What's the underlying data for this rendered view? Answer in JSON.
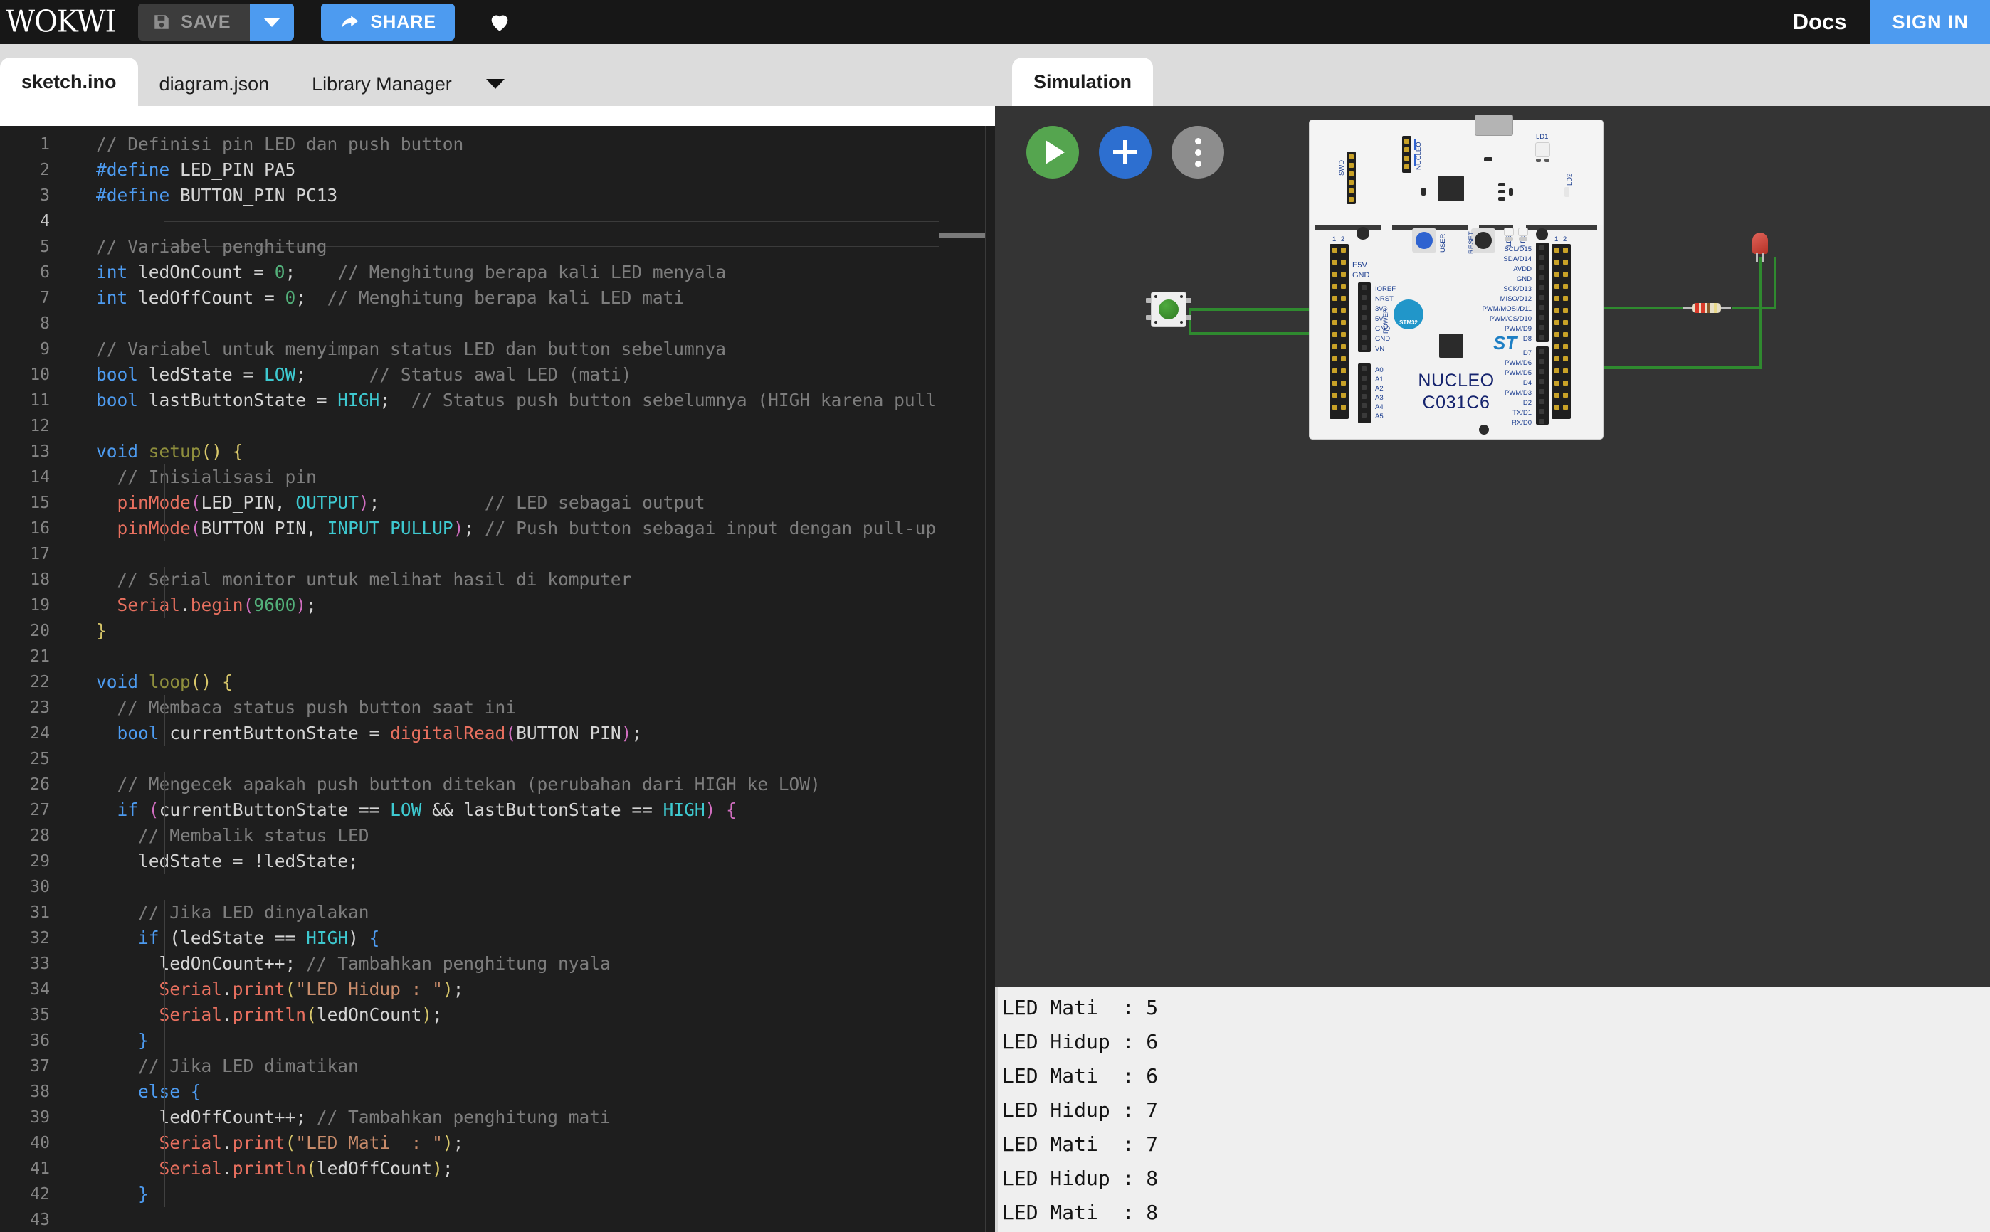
{
  "header": {
    "logo": "WOKWI",
    "save_label": "SAVE",
    "save_icon": "floppy-disk-icon",
    "save_caret_icon": "chevron-down-icon",
    "share_label": "SHARE",
    "share_icon": "share-arrow-icon",
    "heart_icon": "heart-icon",
    "docs_label": "Docs",
    "signin_label": "SIGN IN",
    "accent_blue": "#4d9bf0",
    "bar_bg": "#171717"
  },
  "editor": {
    "tabs": [
      {
        "label": "sketch.ino",
        "active": true
      },
      {
        "label": "diagram.json",
        "active": false
      },
      {
        "label": "Library Manager",
        "active": false
      }
    ],
    "tab_overflow_icon": "chevron-down-icon",
    "current_line": 4,
    "lines": [
      {
        "n": 1,
        "tokens": [
          [
            "c",
            "// Definisi pin LED dan push button"
          ]
        ]
      },
      {
        "n": 2,
        "tokens": [
          [
            "pp",
            "#define"
          ],
          [
            "id",
            " LED_PIN PA5"
          ]
        ]
      },
      {
        "n": 3,
        "tokens": [
          [
            "pp",
            "#define"
          ],
          [
            "id",
            " BUTTON_PIN PC13"
          ]
        ]
      },
      {
        "n": 4,
        "tokens": []
      },
      {
        "n": 5,
        "tokens": [
          [
            "c",
            "// Variabel penghitung"
          ]
        ]
      },
      {
        "n": 6,
        "tokens": [
          [
            "kw",
            "int"
          ],
          [
            "id",
            " ledOnCount = "
          ],
          [
            "num",
            "0"
          ],
          [
            "id",
            ";"
          ],
          [
            "c",
            "    // Menghitung berapa kali LED menyala"
          ]
        ]
      },
      {
        "n": 7,
        "tokens": [
          [
            "kw",
            "int"
          ],
          [
            "id",
            " ledOffCount = "
          ],
          [
            "num",
            "0"
          ],
          [
            "id",
            ";"
          ],
          [
            "c",
            "  // Menghitung berapa kali LED mati"
          ]
        ]
      },
      {
        "n": 8,
        "tokens": []
      },
      {
        "n": 9,
        "tokens": [
          [
            "c",
            "// Variabel untuk menyimpan status LED dan button sebelumnya"
          ]
        ]
      },
      {
        "n": 10,
        "tokens": [
          [
            "kw",
            "bool"
          ],
          [
            "id",
            " ledState = "
          ],
          [
            "cy",
            "LOW"
          ],
          [
            "id",
            ";"
          ],
          [
            "c",
            "      // Status awal LED (mati)"
          ]
        ]
      },
      {
        "n": 11,
        "tokens": [
          [
            "kw",
            "bool"
          ],
          [
            "id",
            " lastButtonState = "
          ],
          [
            "cy",
            "HIGH"
          ],
          [
            "id",
            ";"
          ],
          [
            "c",
            "  // Status push button sebelumnya (HIGH karena pull-up)"
          ]
        ]
      },
      {
        "n": 12,
        "tokens": []
      },
      {
        "n": 13,
        "tokens": [
          [
            "kw",
            "void"
          ],
          [
            "id",
            " "
          ],
          [
            "fn",
            "setup"
          ],
          [
            "yl",
            "()"
          ],
          [
            "yl",
            " {"
          ]
        ]
      },
      {
        "n": 14,
        "tokens": [
          [
            "id",
            "  "
          ],
          [
            "c",
            "// Inisialisasi pin"
          ]
        ]
      },
      {
        "n": 15,
        "tokens": [
          [
            "id",
            "  "
          ],
          [
            "or",
            "pinMode"
          ],
          [
            "pk",
            "("
          ],
          [
            "id",
            "LED_PIN, "
          ],
          [
            "cy",
            "OUTPUT"
          ],
          [
            "pk",
            ")"
          ],
          [
            "id",
            ";"
          ],
          [
            "c",
            "          // LED sebagai output"
          ]
        ]
      },
      {
        "n": 16,
        "tokens": [
          [
            "id",
            "  "
          ],
          [
            "or",
            "pinMode"
          ],
          [
            "pk",
            "("
          ],
          [
            "id",
            "BUTTON_PIN, "
          ],
          [
            "cy",
            "INPUT_PULLUP"
          ],
          [
            "pk",
            ")"
          ],
          [
            "id",
            ";"
          ],
          [
            "c",
            " // Push button sebagai input dengan pull-up interna"
          ]
        ]
      },
      {
        "n": 17,
        "tokens": []
      },
      {
        "n": 18,
        "tokens": [
          [
            "id",
            "  "
          ],
          [
            "c",
            "// Serial monitor untuk melihat hasil di komputer"
          ]
        ]
      },
      {
        "n": 19,
        "tokens": [
          [
            "id",
            "  "
          ],
          [
            "or",
            "Serial"
          ],
          [
            "id",
            "."
          ],
          [
            "or",
            "begin"
          ],
          [
            "pk",
            "("
          ],
          [
            "num",
            "9600"
          ],
          [
            "pk",
            ")"
          ],
          [
            "id",
            ";"
          ]
        ]
      },
      {
        "n": 20,
        "tokens": [
          [
            "yl",
            "}"
          ]
        ]
      },
      {
        "n": 21,
        "tokens": []
      },
      {
        "n": 22,
        "tokens": [
          [
            "kw",
            "void"
          ],
          [
            "id",
            " "
          ],
          [
            "fn",
            "loop"
          ],
          [
            "yl",
            "()"
          ],
          [
            "yl",
            " {"
          ]
        ]
      },
      {
        "n": 23,
        "tokens": [
          [
            "id",
            "  "
          ],
          [
            "c",
            "// Membaca status push button saat ini"
          ]
        ]
      },
      {
        "n": 24,
        "tokens": [
          [
            "id",
            "  "
          ],
          [
            "kw",
            "bool"
          ],
          [
            "id",
            " currentButtonState = "
          ],
          [
            "or",
            "digitalRead"
          ],
          [
            "pk",
            "("
          ],
          [
            "id",
            "BUTTON_PIN"
          ],
          [
            "pk",
            ")"
          ],
          [
            "id",
            ";"
          ]
        ]
      },
      {
        "n": 25,
        "tokens": []
      },
      {
        "n": 26,
        "tokens": [
          [
            "id",
            "  "
          ],
          [
            "c",
            "// Mengecek apakah push button ditekan (perubahan dari HIGH ke LOW)"
          ]
        ]
      },
      {
        "n": 27,
        "tokens": [
          [
            "id",
            "  "
          ],
          [
            "kw",
            "if"
          ],
          [
            "id",
            " "
          ],
          [
            "pk",
            "("
          ],
          [
            "id",
            "currentButtonState == "
          ],
          [
            "cy",
            "LOW"
          ],
          [
            "id",
            " && lastButtonState == "
          ],
          [
            "cy",
            "HIGH"
          ],
          [
            "pk",
            ")"
          ],
          [
            "pk",
            " {"
          ]
        ]
      },
      {
        "n": 28,
        "tokens": [
          [
            "id",
            "    "
          ],
          [
            "c",
            "// Membalik status LED"
          ]
        ]
      },
      {
        "n": 29,
        "tokens": [
          [
            "id",
            "    ledState = !ledState;"
          ]
        ]
      },
      {
        "n": 30,
        "tokens": []
      },
      {
        "n": 31,
        "tokens": [
          [
            "id",
            "    "
          ],
          [
            "c",
            "// Jika LED dinyalakan"
          ]
        ]
      },
      {
        "n": 32,
        "tokens": [
          [
            "id",
            "    "
          ],
          [
            "kw",
            "if"
          ],
          [
            "id",
            " ("
          ],
          [
            "id",
            "ledState == "
          ],
          [
            "cy",
            "HIGH"
          ],
          [
            "id",
            ") "
          ],
          [
            "bl",
            "{"
          ]
        ]
      },
      {
        "n": 33,
        "tokens": [
          [
            "id",
            "      ledOnCount++; "
          ],
          [
            "c",
            "// Tambahkan penghitung nyala"
          ]
        ]
      },
      {
        "n": 34,
        "tokens": [
          [
            "id",
            "      "
          ],
          [
            "or",
            "Serial"
          ],
          [
            "id",
            "."
          ],
          [
            "or",
            "print"
          ],
          [
            "yl",
            "("
          ],
          [
            "st",
            "\"LED Hidup : \""
          ],
          [
            "yl",
            ")"
          ],
          [
            "id",
            ";"
          ]
        ]
      },
      {
        "n": 35,
        "tokens": [
          [
            "id",
            "      "
          ],
          [
            "or",
            "Serial"
          ],
          [
            "id",
            "."
          ],
          [
            "or",
            "println"
          ],
          [
            "yl",
            "("
          ],
          [
            "id",
            "ledOnCount"
          ],
          [
            "yl",
            ")"
          ],
          [
            "id",
            ";"
          ]
        ]
      },
      {
        "n": 36,
        "tokens": [
          [
            "id",
            "    "
          ],
          [
            "bl",
            "}"
          ]
        ]
      },
      {
        "n": 37,
        "tokens": [
          [
            "id",
            "    "
          ],
          [
            "c",
            "// Jika LED dimatikan"
          ]
        ]
      },
      {
        "n": 38,
        "tokens": [
          [
            "id",
            "    "
          ],
          [
            "kw",
            "else"
          ],
          [
            "id",
            " "
          ],
          [
            "bl",
            "{"
          ]
        ]
      },
      {
        "n": 39,
        "tokens": [
          [
            "id",
            "      ledOffCount++; "
          ],
          [
            "c",
            "// Tambahkan penghitung mati"
          ]
        ]
      },
      {
        "n": 40,
        "tokens": [
          [
            "id",
            "      "
          ],
          [
            "or",
            "Serial"
          ],
          [
            "id",
            "."
          ],
          [
            "or",
            "print"
          ],
          [
            "yl",
            "("
          ],
          [
            "st",
            "\"LED Mati  : \""
          ],
          [
            "yl",
            ")"
          ],
          [
            "id",
            ";"
          ]
        ]
      },
      {
        "n": 41,
        "tokens": [
          [
            "id",
            "      "
          ],
          [
            "or",
            "Serial"
          ],
          [
            "id",
            "."
          ],
          [
            "or",
            "println"
          ],
          [
            "yl",
            "("
          ],
          [
            "id",
            "ledOffCount"
          ],
          [
            "yl",
            ")"
          ],
          [
            "id",
            ";"
          ]
        ]
      },
      {
        "n": 42,
        "tokens": [
          [
            "id",
            "    "
          ],
          [
            "bl",
            "}"
          ]
        ]
      },
      {
        "n": 43,
        "tokens": []
      }
    ]
  },
  "simulation": {
    "tab_label": "Simulation",
    "controls": [
      {
        "name": "play-button",
        "icon": "play-icon",
        "color": "#55a54f"
      },
      {
        "name": "add-part-button",
        "icon": "plus-icon",
        "color": "#2d6fd0"
      },
      {
        "name": "more-options-button",
        "icon": "kebab-menu-icon",
        "color": "#8d8d8d"
      }
    ],
    "board": {
      "name_line1": "NUCLEO",
      "name_line2": "C031C6",
      "vendor": "ST",
      "mcu_badge": "STM32",
      "labels_left_power": [
        "IOREF",
        "NRST",
        "3V3",
        "5V",
        "GND",
        "GND",
        "VN"
      ],
      "labels_left_analog": [
        "A0",
        "A1",
        "A2",
        "A3",
        "A4",
        "A5"
      ],
      "labels_left_top": [
        "E5V",
        "GND"
      ],
      "power_group_label": "POWER",
      "labels_right_upper": [
        "SCL/D15",
        "SDA/D14",
        "AVDD",
        "GND",
        "SCK/D13",
        "MISO/D12",
        "PWM/MOSI/D11",
        "PWM/CS/D10",
        "PWM/D9",
        "D8"
      ],
      "labels_right_lower": [
        "D7",
        "PWM/D6",
        "PWM/D5",
        "D4",
        "PWM/D3",
        "D2",
        "TX/D1",
        "RX/D0"
      ],
      "header_labels": [
        "SWD",
        "NUCLEO"
      ],
      "led_labels": [
        "LD1",
        "LD2",
        "LD3",
        "LD4"
      ],
      "buttons": [
        "USER",
        "RESET"
      ],
      "row_markers": [
        "1",
        "2"
      ]
    },
    "parts": [
      {
        "name": "pushbutton",
        "color": "#3e8c2f",
        "label": ""
      },
      {
        "name": "led",
        "color": "#c43a2c",
        "label": ""
      },
      {
        "name": "resistor",
        "bands": [
          "#d83a2a",
          "#d83a2a",
          "#8a5a2b",
          "#e8d98a"
        ]
      }
    ],
    "wire_color": "#2f8a2f"
  },
  "serial_monitor": {
    "lines": [
      "LED Mati  : 5",
      "LED Hidup : 6",
      "LED Mati  : 6",
      "LED Hidup : 7",
      "LED Mati  : 7",
      "LED Hidup : 8",
      "LED Mati  : 8"
    ]
  }
}
